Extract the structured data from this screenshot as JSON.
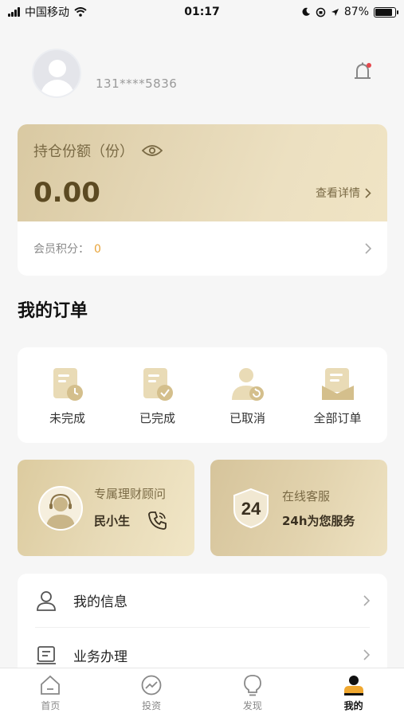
{
  "status_bar": {
    "carrier": "中国移动",
    "time": "01:17",
    "battery": "87%"
  },
  "profile": {
    "phone": "131****5836"
  },
  "holding": {
    "title": "持仓份额（份）",
    "amount": "0.00",
    "detail_link": "查看详情",
    "points_label": "会员积分：",
    "points_value": "0"
  },
  "orders": {
    "section_title": "我的订单",
    "items": [
      {
        "label": "未完成",
        "icon": "pending-order-icon"
      },
      {
        "label": "已完成",
        "icon": "completed-order-icon"
      },
      {
        "label": "已取消",
        "icon": "cancelled-order-icon"
      },
      {
        "label": "全部订单",
        "icon": "all-orders-icon"
      }
    ]
  },
  "advisor": {
    "title": "专属理财顾问",
    "name": "民小生"
  },
  "customer_service": {
    "badge": "24",
    "title": "在线客服",
    "subtitle": "24h为您服务"
  },
  "menu": [
    {
      "label": "我的信息",
      "icon": "user-icon"
    },
    {
      "label": "业务办理",
      "icon": "business-icon"
    }
  ],
  "tabbar": [
    {
      "label": "首页",
      "icon": "home-icon",
      "active": false
    },
    {
      "label": "投资",
      "icon": "invest-icon",
      "active": false
    },
    {
      "label": "发现",
      "icon": "discover-icon",
      "active": false
    },
    {
      "label": "我的",
      "icon": "profile-icon",
      "active": true
    }
  ],
  "colors": {
    "gold": "#e3d5b3",
    "accent": "#e8a43a",
    "amount": "#5c4a22"
  }
}
